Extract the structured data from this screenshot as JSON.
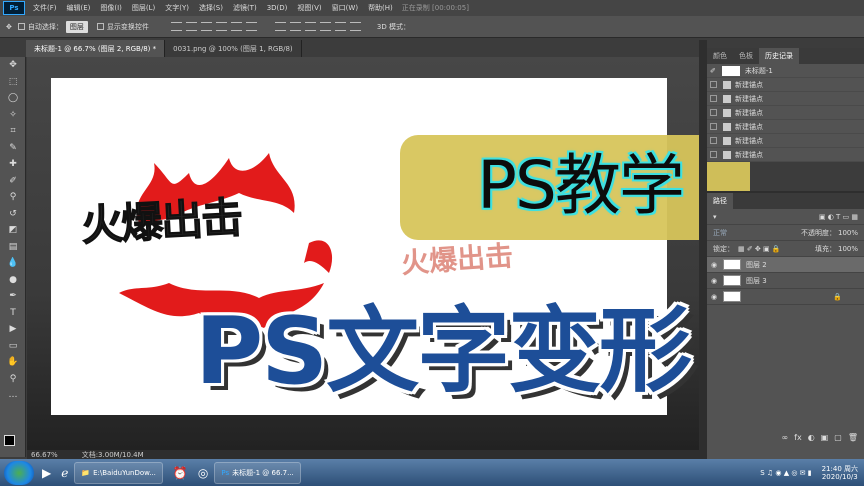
{
  "menu": {
    "logo": "Ps",
    "items": [
      "文件(F)",
      "编辑(E)",
      "图像(I)",
      "图层(L)",
      "文字(Y)",
      "选择(S)",
      "滤镜(T)",
      "3D(D)",
      "视图(V)",
      "窗口(W)",
      "帮助(H)"
    ],
    "recording": "正在录制 [00:00:05]"
  },
  "options": {
    "auto_select_label": "自动选择：",
    "auto_select_value": "图层",
    "show_transform_label": "显示变换控件",
    "mode_3d": "3D 模式："
  },
  "tabs": [
    {
      "label": "未标题-1 @ 66.7% (图层 2, RGB/8) *",
      "active": true
    },
    {
      "label": "0031.png @ 100% (图层 1, RGB/8)",
      "active": false
    }
  ],
  "canvas": {
    "logo_text": "火爆出击",
    "faded_text": "火爆出击"
  },
  "overlay": {
    "title_top": "PS教学",
    "title_main": "PS文字变形"
  },
  "status": {
    "zoom": "66.67%",
    "doc": "文档:3.00M/10.4M"
  },
  "panels": {
    "top_tabs": [
      "颜色",
      "色板",
      "历史记录"
    ],
    "history_doc": "未标题-1",
    "history_items": [
      "新建锚点",
      "新建锚点",
      "新建锚点",
      "新建锚点",
      "新建锚点",
      "新建锚点"
    ],
    "layers_tab": "路径",
    "blend_mode": "正常",
    "opacity_label": "不透明度：",
    "opacity_value": "100%",
    "lock_label": "锁定：",
    "fill_label": "填充：",
    "fill_value": "100%",
    "layers": [
      "图层 2",
      "图层 3"
    ],
    "layer_tools": [
      "fx",
      "◐",
      "▣",
      "▢",
      "🗑"
    ]
  },
  "ime": {
    "brand": "S",
    "label": "中"
  },
  "taskbar": {
    "items": [
      "E:\\BaiduYunDow...",
      "未标题-1 @ 66.7..."
    ],
    "time": "21:40 周六",
    "date": "2020/10/3"
  }
}
